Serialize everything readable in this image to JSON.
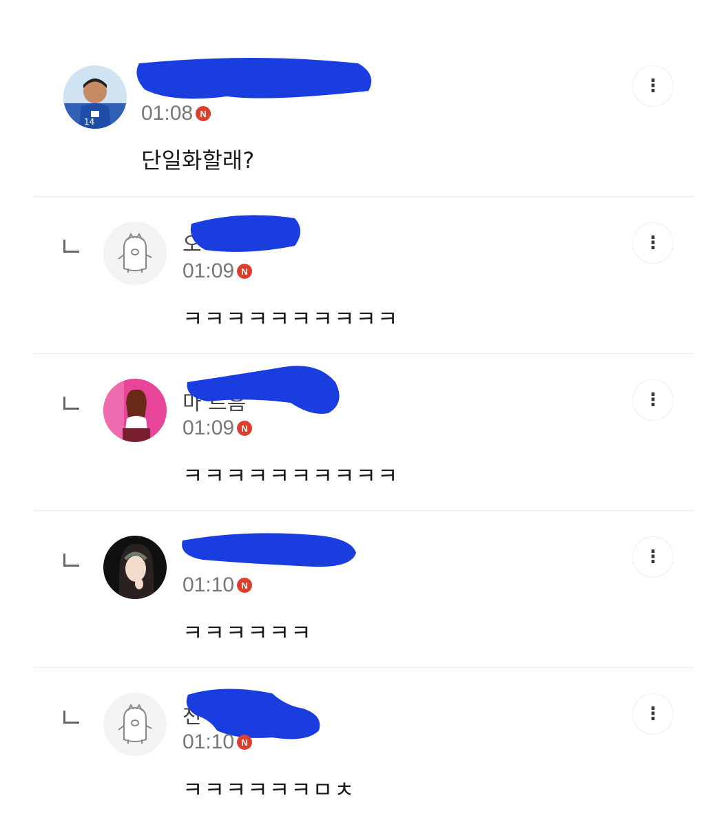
{
  "comments": [
    {
      "name_visible": "",
      "time": "01:08",
      "badge": "N",
      "text": "단일화할래?",
      "avatar": "soccer-player-avatar",
      "more_icon": "⋮"
    },
    {
      "name_visible": "오",
      "time": "01:09",
      "badge": "N",
      "text": "ㅋㅋㅋㅋㅋㅋㅋㅋㅋㅋ",
      "avatar": "default-bird-avatar",
      "more_icon": "⋮"
    },
    {
      "name_visible": "마  르흠",
      "time": "01:09",
      "badge": "N",
      "text": "ㅋㅋㅋㅋㅋㅋㅋㅋㅋㅋ",
      "avatar": "pink-singer-avatar",
      "more_icon": "⋮"
    },
    {
      "name_visible": "",
      "time": "01:10",
      "badge": "N",
      "text": "ㅋㅋㅋㅋㅋㅋ",
      "avatar": "woman-portrait-avatar",
      "more_icon": "⋮"
    },
    {
      "name_visible": "천",
      "time": "01:10",
      "badge": "N",
      "text": "ㅋㅋㅋㅋㅋㅋㅁㅊ",
      "avatar": "default-bird-avatar",
      "more_icon": "⋮"
    }
  ],
  "colors": {
    "redaction": "#1a3de0",
    "badge": "#e03e2d",
    "divider": "#ececec"
  }
}
